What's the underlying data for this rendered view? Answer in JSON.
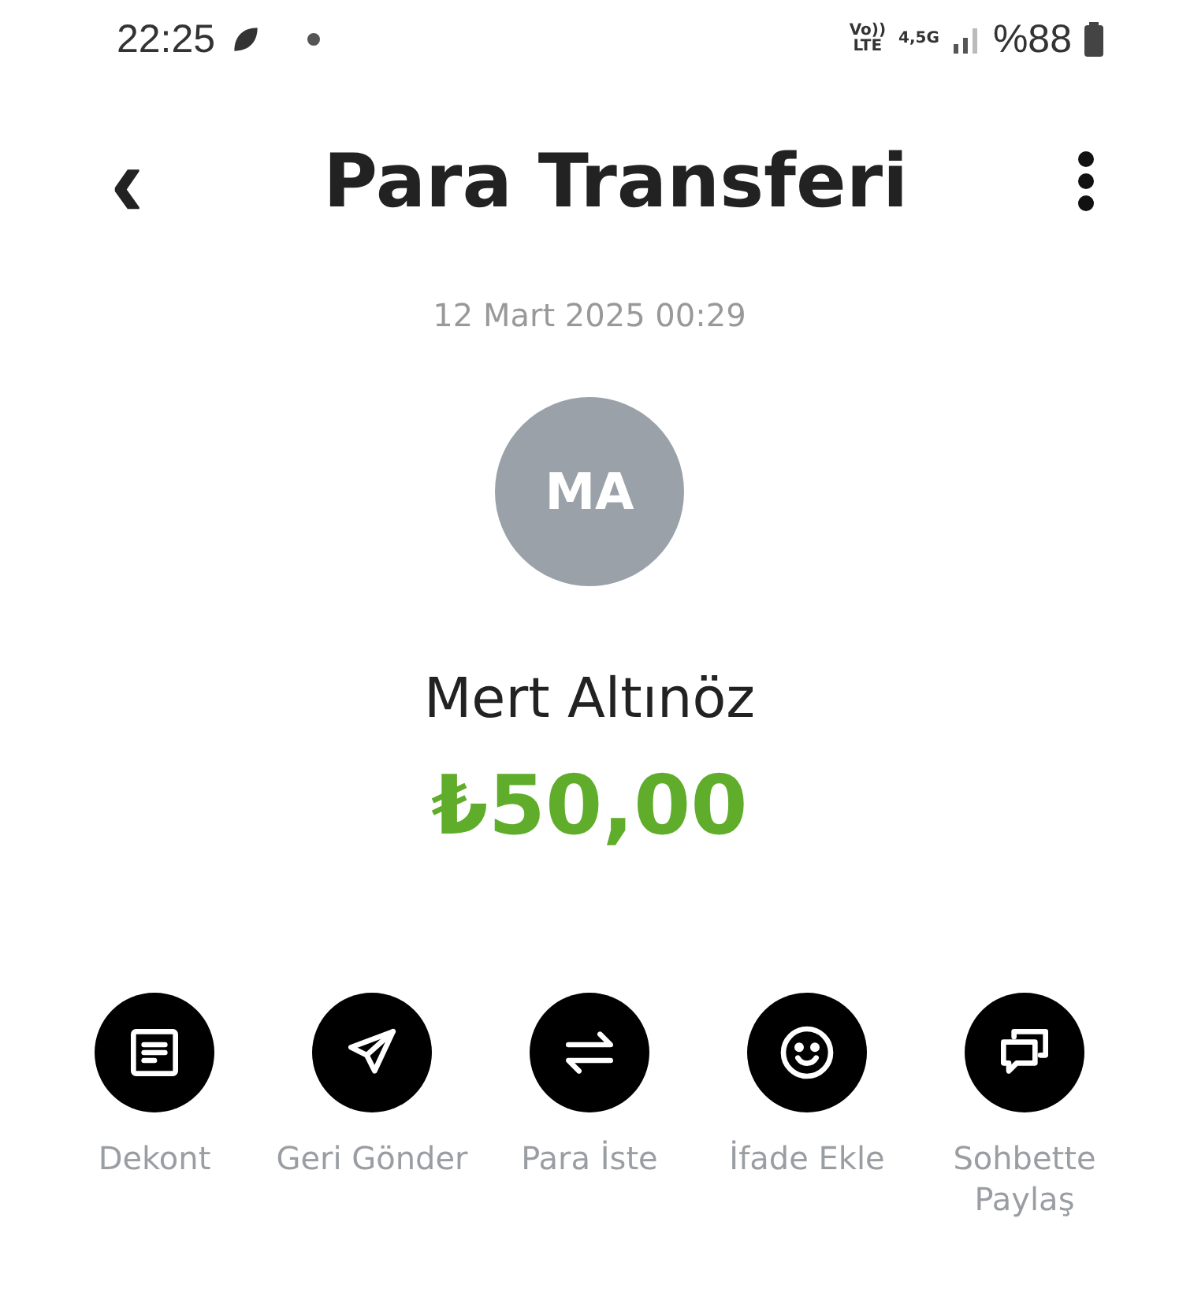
{
  "status_bar": {
    "time": "22:25",
    "volte_top": "Vo))",
    "volte_bottom": "LTE",
    "network": "4,5G",
    "battery": "%88"
  },
  "header": {
    "back": "‹",
    "title": "Para Transferi"
  },
  "date": "12 Mart 2025 00:29",
  "avatar": {
    "initials": "MA"
  },
  "name": "Mert Altınöz",
  "amount": "₺50,00",
  "actions": [
    {
      "kind": "receipt",
      "label": "Dekont"
    },
    {
      "kind": "send",
      "label": "Geri Gönder"
    },
    {
      "kind": "swap",
      "label": "Para İste"
    },
    {
      "kind": "smile",
      "label": "İfade Ekle"
    },
    {
      "kind": "chat",
      "label": "Sohbette Paylaş"
    }
  ]
}
